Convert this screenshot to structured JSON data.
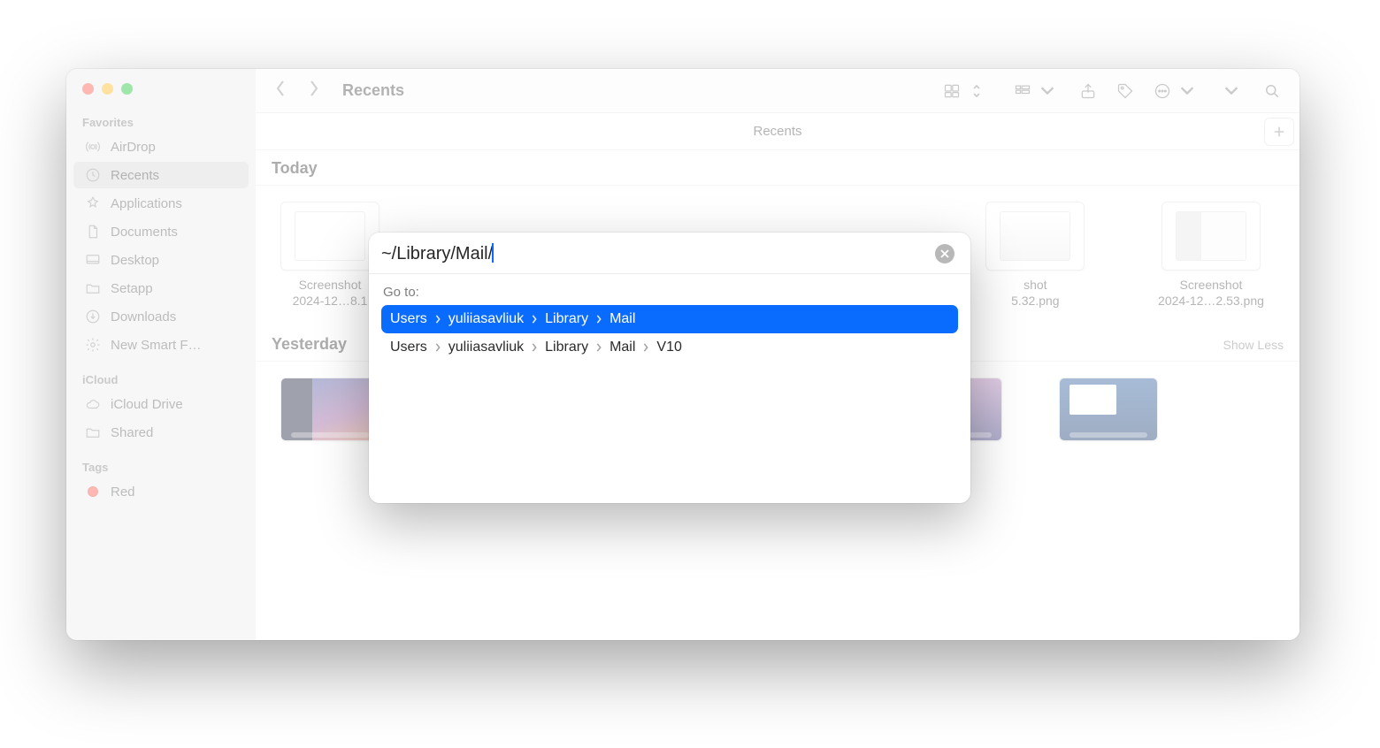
{
  "window": {
    "title": "Recents",
    "location_label": "Recents"
  },
  "sidebar": {
    "sections": {
      "favorites_label": "Favorites",
      "icloud_label": "iCloud",
      "tags_label": "Tags"
    },
    "favorites": [
      {
        "label": "AirDrop"
      },
      {
        "label": "Recents"
      },
      {
        "label": "Applications"
      },
      {
        "label": "Documents"
      },
      {
        "label": "Desktop"
      },
      {
        "label": "Setapp"
      },
      {
        "label": "Downloads"
      },
      {
        "label": "New Smart F…"
      }
    ],
    "icloud": [
      {
        "label": "iCloud Drive"
      },
      {
        "label": "Shared"
      }
    ],
    "tags": [
      {
        "label": "Red"
      }
    ]
  },
  "content": {
    "sections": [
      {
        "title": "Today",
        "items": [
          {
            "name_line1": "Screenshot",
            "name_line2": "2024-12…8.1"
          },
          {
            "name_line1": "shot",
            "name_line2": "5.32.png"
          },
          {
            "name_line1": "Screenshot",
            "name_line2": "2024-12…2.53.png"
          }
        ]
      },
      {
        "title": "Yesterday",
        "show_less": "Show Less"
      }
    ]
  },
  "goto": {
    "input_value": "~/Library/Mail/",
    "label": "Go to:",
    "suggestions": [
      {
        "segments": [
          "Users",
          "yuliiasavliuk",
          "Library",
          "Mail"
        ],
        "selected": true
      },
      {
        "segments": [
          "Users",
          "yuliiasavliuk",
          "Library",
          "Mail",
          "V10"
        ],
        "selected": false
      }
    ]
  }
}
